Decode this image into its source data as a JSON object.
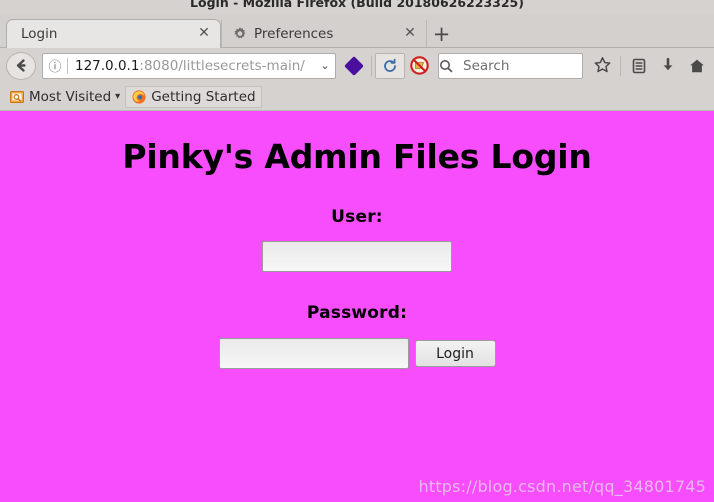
{
  "window": {
    "title": "Login - Mozilla Firefox (Build 20180626223325)"
  },
  "tabs": [
    {
      "label": "Login",
      "favicon": "none",
      "close_glyph": "✕",
      "active": true
    },
    {
      "label": "Preferences",
      "favicon": "gear-icon",
      "close_glyph": "✕",
      "active": false
    }
  ],
  "newtab": {
    "label": "+"
  },
  "toolbar": {
    "back_glyph": "←",
    "identity_glyph": "ⓘ",
    "url_host": "127.0.0.1",
    "url_path": ":8080/littlesecrets-main/",
    "url_chevron": "⌄",
    "container_icon": "purple-diamond-icon",
    "reload_glyph": "↻",
    "noscript_icon": "noscript-blocked-icon",
    "search_glyph": "⚲",
    "search_placeholder": "Search",
    "bookmark_star": "☆",
    "library_icon": "library-icon",
    "downloads_icon": "download-arrow-icon",
    "home_icon": "home-icon"
  },
  "bookmarks": [
    {
      "label": "Most Visited",
      "icon": "most-visited-icon",
      "caret": "▾",
      "framed": false
    },
    {
      "label": "Getting Started",
      "icon": "firefox-icon",
      "caret": "",
      "framed": true
    }
  ],
  "page": {
    "background_color": "#f84dfc",
    "heading": "Pinky's Admin Files Login",
    "user_label": "User:",
    "user_value": "",
    "user_placeholder": "",
    "password_label": "Password:",
    "password_value": "",
    "password_placeholder": "",
    "login_button": "Login",
    "watermark": "https://blog.csdn.net/qq_34801745"
  }
}
